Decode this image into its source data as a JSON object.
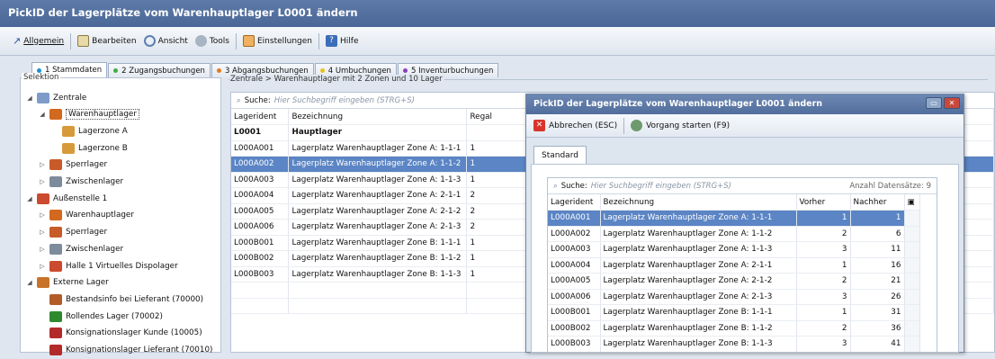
{
  "window": {
    "title": "PickID der Lagerplätze vom Warenhauptlager L0001 ändern"
  },
  "menu": {
    "back": "Allgemein",
    "edit": "Bearbeiten",
    "view": "Ansicht",
    "tools": "Tools",
    "settings": "Einstellungen",
    "help": "Hilfe"
  },
  "tabs": [
    {
      "label": "1 Stammdaten",
      "color": "#1a8fd6"
    },
    {
      "label": "2 Zugangsbuchungen",
      "color": "#3fae3f"
    },
    {
      "label": "3 Abgangsbuchungen",
      "color": "#e07b1a"
    },
    {
      "label": "4 Umbuchungen",
      "color": "#e9c21c"
    },
    {
      "label": "5 Inventurbuchungen",
      "color": "#8c3fbd"
    }
  ],
  "left": {
    "section_label": "Selektion",
    "tree": [
      {
        "label": "Zentrale",
        "expander": "◢",
        "icon": "building-icon",
        "color": "#7d9cc8"
      },
      {
        "label": "Warenhauptlager",
        "expander": "◢",
        "icon": "forklift-icon",
        "color": "#d2691e"
      },
      {
        "label": "Lagerzone A",
        "expander": "",
        "icon": "shelf-icon",
        "color": "#d79a3a"
      },
      {
        "label": "Lagerzone B",
        "expander": "",
        "icon": "shelf-icon",
        "color": "#d79a3a"
      },
      {
        "label": "Sperrlager",
        "expander": "▷",
        "icon": "forklift-icon",
        "color": "#c85b2a"
      },
      {
        "label": "Zwischenlager",
        "expander": "▷",
        "icon": "forklift-icon",
        "color": "#7d8c9c"
      },
      {
        "label": "Außenstelle 1",
        "expander": "◢",
        "icon": "house-icon",
        "color": "#cc4a2f"
      },
      {
        "label": "Warenhauptlager",
        "expander": "▷",
        "icon": "forklift-icon",
        "color": "#d2691e"
      },
      {
        "label": "Sperrlager",
        "expander": "▷",
        "icon": "forklift-icon",
        "color": "#c85b2a"
      },
      {
        "label": "Zwischenlager",
        "expander": "▷",
        "icon": "forklift-icon",
        "color": "#7d8c9c"
      },
      {
        "label": "Halle 1 Virtuelles Dispolager",
        "expander": "▷",
        "icon": "house-icon",
        "color": "#cc4a2f"
      },
      {
        "label": "Externe Lager",
        "expander": "◢",
        "icon": "warehouse-icon",
        "color": "#c8722a"
      },
      {
        "label": "Bestandsinfo bei Lieferant (70000)",
        "expander": "",
        "icon": "truck-icon",
        "color": "#b35c2a"
      },
      {
        "label": "Rollendes Lager (70002)",
        "expander": "",
        "icon": "truck-icon",
        "color": "#2f8a2f"
      },
      {
        "label": "Konsignationslager Kunde (10005)",
        "expander": "",
        "icon": "truck-icon",
        "color": "#b32a2a"
      },
      {
        "label": "Konsignationslager Lieferant (70010)",
        "expander": "",
        "icon": "truck-icon",
        "color": "#b32a2a"
      }
    ]
  },
  "main": {
    "breadcrumb": "Zentrale > Warenhauptlager mit 2 Zonen und 10 Lager",
    "search_label": "Suche:",
    "search_placeholder": "Hier Suchbegriff eingeben (STRG+S)",
    "columns": [
      "Lagerident",
      "Bezeichnung",
      "Regal"
    ],
    "rows": [
      {
        "id": "L0001",
        "name": "Hauptlager",
        "regal": ""
      },
      {
        "id": "L000A001",
        "name": "Lagerplatz Warenhauptlager Zone A: 1-1-1",
        "regal": "1"
      },
      {
        "id": "L000A002",
        "name": "Lagerplatz Warenhauptlager Zone A: 1-1-2",
        "regal": "1"
      },
      {
        "id": "L000A003",
        "name": "Lagerplatz Warenhauptlager Zone A: 1-1-3",
        "regal": "1"
      },
      {
        "id": "L000A004",
        "name": "Lagerplatz Warenhauptlager Zone A: 2-1-1",
        "regal": "2"
      },
      {
        "id": "L000A005",
        "name": "Lagerplatz Warenhauptlager Zone A: 2-1-2",
        "regal": "2"
      },
      {
        "id": "L000A006",
        "name": "Lagerplatz Warenhauptlager Zone A: 2-1-3",
        "regal": "2"
      },
      {
        "id": "L000B001",
        "name": "Lagerplatz Warenhauptlager Zone B: 1-1-1",
        "regal": "1"
      },
      {
        "id": "L000B002",
        "name": "Lagerplatz Warenhauptlager Zone B: 1-1-2",
        "regal": "1"
      },
      {
        "id": "L000B003",
        "name": "Lagerplatz Warenhauptlager Zone B: 1-1-3",
        "regal": "1"
      }
    ]
  },
  "dialog": {
    "title": "PickID der Lagerplätze vom Warenhauptlager L0001 ändern",
    "cancel": "Abbrechen (ESC)",
    "start": "Vorgang starten (F9)",
    "tab": "Standard",
    "search_label": "Suche:",
    "search_placeholder": "Hier Suchbegriff eingeben (STRG+S)",
    "count_label": "Anzahl Datensätze: 9",
    "columns": [
      "Lagerident",
      "Bezeichnung",
      "Vorher",
      "Nachher"
    ],
    "rows": [
      {
        "id": "L000A001",
        "name": "Lagerplatz Warenhauptlager Zone A: 1-1-1",
        "before": "1",
        "after": "1"
      },
      {
        "id": "L000A002",
        "name": "Lagerplatz Warenhauptlager Zone A: 1-1-2",
        "before": "2",
        "after": "6"
      },
      {
        "id": "L000A003",
        "name": "Lagerplatz Warenhauptlager Zone A: 1-1-3",
        "before": "3",
        "after": "11"
      },
      {
        "id": "L000A004",
        "name": "Lagerplatz Warenhauptlager Zone A: 2-1-1",
        "before": "1",
        "after": "16"
      },
      {
        "id": "L000A005",
        "name": "Lagerplatz Warenhauptlager Zone A: 2-1-2",
        "before": "2",
        "after": "21"
      },
      {
        "id": "L000A006",
        "name": "Lagerplatz Warenhauptlager Zone A: 2-1-3",
        "before": "3",
        "after": "26"
      },
      {
        "id": "L000B001",
        "name": "Lagerplatz Warenhauptlager Zone B: 1-1-1",
        "before": "1",
        "after": "31"
      },
      {
        "id": "L000B002",
        "name": "Lagerplatz Warenhauptlager Zone B: 1-1-2",
        "before": "2",
        "after": "36"
      },
      {
        "id": "L000B003",
        "name": "Lagerplatz Warenhauptlager Zone B: 1-1-3",
        "before": "3",
        "after": "41"
      }
    ]
  }
}
